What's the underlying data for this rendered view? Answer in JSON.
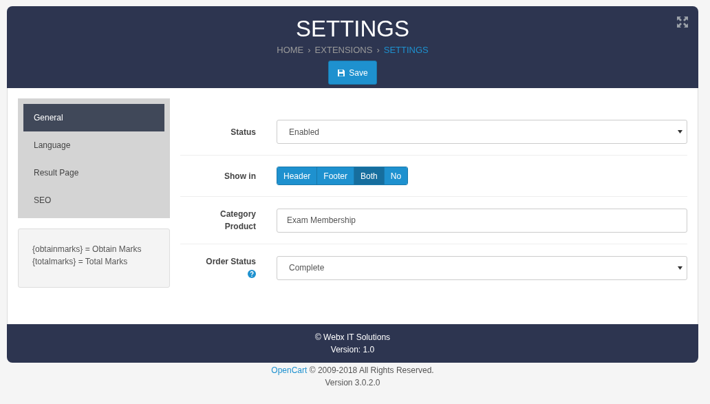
{
  "header": {
    "title": "SETTINGS",
    "breadcrumb": [
      {
        "label": "HOME",
        "current": false
      },
      {
        "label": "EXTENSIONS",
        "separator": "›",
        "current": false
      },
      {
        "label": "SETTINGS",
        "separator": "›",
        "current": true
      }
    ],
    "save_button": "Save"
  },
  "sidebar": {
    "items": [
      {
        "label": "General",
        "selected": true
      },
      {
        "label": "Language",
        "selected": false
      },
      {
        "label": "Result Page",
        "selected": false
      },
      {
        "label": "SEO",
        "selected": false
      }
    ],
    "note": [
      "{obtainmarks} = Obtain Marks",
      "{totalmarks} = Total Marks"
    ]
  },
  "form": [
    {
      "kind": "select",
      "label": "Status",
      "value": "Enabled",
      "help": false
    },
    {
      "kind": "toggle",
      "label": "Show in",
      "options": [
        {
          "label": "Header",
          "selected": false
        },
        {
          "label": "Footer",
          "selected": false
        },
        {
          "label": "Both",
          "selected": true
        },
        {
          "label": "No",
          "selected": false
        }
      ],
      "help": false
    },
    {
      "kind": "text",
      "label": "Category Product",
      "value": "Exam Membership",
      "help": false
    },
    {
      "kind": "select",
      "label": "Order Status",
      "value": "Complete",
      "help": true
    }
  ],
  "footer": {
    "lines": [
      "© Webx IT Solutions",
      "Version: 1.0"
    ]
  },
  "page_footer": {
    "link": "OpenCart",
    "copyright": "© 2009-2018 All Rights Reserved.",
    "version": "Version 3.0.2.0"
  }
}
